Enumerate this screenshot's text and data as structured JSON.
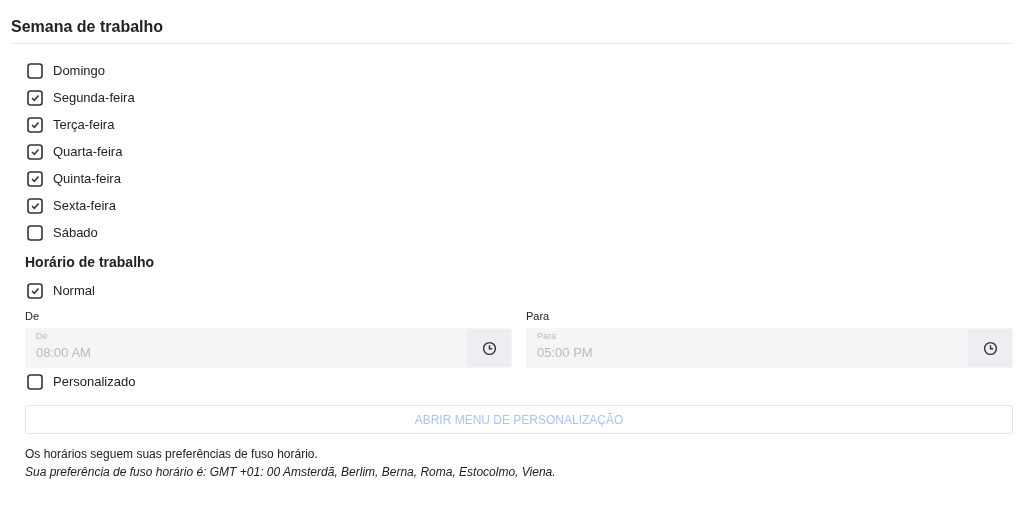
{
  "title": "Semana de trabalho",
  "days": [
    {
      "label": "Domingo",
      "checked": false
    },
    {
      "label": "Segunda-feira",
      "checked": true
    },
    {
      "label": "Terça-feira",
      "checked": true
    },
    {
      "label": "Quarta-feira",
      "checked": true
    },
    {
      "label": "Quinta-feira",
      "checked": true
    },
    {
      "label": "Sexta-feira",
      "checked": true
    },
    {
      "label": "Sábado",
      "checked": false
    }
  ],
  "hours": {
    "title": "Horário de trabalho",
    "normal": {
      "label": "Normal",
      "checked": true
    },
    "fields": [
      {
        "label": "De",
        "floating_label": "De",
        "value": "08:00 AM",
        "disabled": true
      },
      {
        "label": "Para",
        "floating_label": "Para",
        "value": "05:00 PM",
        "disabled": true
      }
    ],
    "custom": {
      "label": "Personalizado",
      "checked": false
    },
    "button": {
      "label": "ABRIR MENU DE PERSONALIZAÇÃO",
      "disabled": true
    }
  },
  "note": "Os horários seguem suas preferências de fuso horário.",
  "timezone": "Sua preferência de fuso horário é: GMT +01: 00 Amsterdã, Berlim, Berna, Roma, Estocolmo, Viena."
}
